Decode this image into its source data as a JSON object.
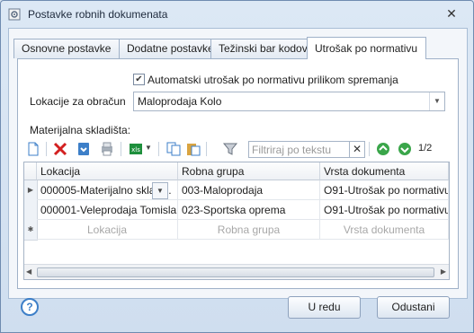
{
  "window": {
    "title": "Postavke robnih dokumenata",
    "icon": "settings-doc-icon"
  },
  "tabs": [
    {
      "label": "Osnovne postavke",
      "active": false
    },
    {
      "label": "Dodatne postavke",
      "active": false
    },
    {
      "label": "Težinski bar kodovi",
      "active": false
    },
    {
      "label": "Utrošak po normativu",
      "active": true
    }
  ],
  "form": {
    "auto_checkbox_label": "Automatski utrošak po normativu prilikom spremanja",
    "auto_checked": true,
    "location_label": "Lokacije za obračun",
    "location_value": "Maloprodaja Kolo",
    "warehouses_label": "Materijalna skladišta:"
  },
  "toolbar": {
    "filter_placeholder": "Filtriraj po tekstu",
    "page_indicator": "1/2"
  },
  "grid": {
    "columns": [
      "Lokacija",
      "Robna grupa",
      "Vrsta dokumenta"
    ],
    "rows": [
      [
        "000005-Materijalno sklad…",
        "003-Maloprodaja",
        "O91-Utrošak po normativu"
      ],
      [
        "000001-Veleprodaja Tomisla…",
        "023-Sportska oprema",
        "O91-Utrošak po normativu"
      ]
    ],
    "new_row": [
      "Lokacija",
      "Robna grupa",
      "Vrsta dokumenta"
    ]
  },
  "buttons": {
    "ok": "U redu",
    "cancel": "Odustani"
  }
}
